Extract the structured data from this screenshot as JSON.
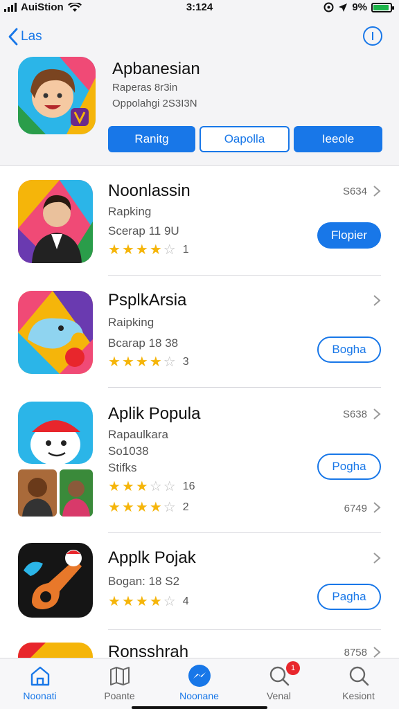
{
  "status_bar": {
    "carrier": "AuiStion",
    "time": "3:124",
    "battery": "9%",
    "battery_level": 0.9
  },
  "nav": {
    "back_label": "Las"
  },
  "hero": {
    "title": "Apbanesian",
    "subtitle_1": "Raperas 8r3in",
    "subtitle_2": "Oppolahgi 2S3I3N",
    "segments": [
      {
        "label": "Ranitg"
      },
      {
        "label": "Oapolla"
      },
      {
        "label": "Ieeole"
      }
    ]
  },
  "apps": [
    {
      "name": "Noonlassin",
      "line_1": "Rapking",
      "line_2": "Scerap 11 9U",
      "rating": 4.5,
      "count": "1",
      "number": "S634",
      "action": "Flopier"
    },
    {
      "name": "PsplkArsia",
      "line_1": "Raipking",
      "line_2": "Bcarap 18 38",
      "rating": 4.5,
      "count": "3",
      "action": "Bogha"
    },
    {
      "name": "Aplik Popula",
      "line_1": "Rapaulkara",
      "line_2": "So1038",
      "line_3": "Stifks",
      "rating": 3.0,
      "count": "16",
      "rating_2": 4.5,
      "count_2": "2",
      "number": "S638",
      "number_2": "6749",
      "action": "Pogha"
    },
    {
      "name": "Applk Pojak",
      "line_1": "Bogan: 18 S2",
      "rating": 4.5,
      "count": "4",
      "action": "Pagha"
    },
    {
      "name": "Ronsshrah",
      "number": "8758"
    }
  ],
  "tab_bar": {
    "tabs": [
      {
        "label": "Noonati",
        "icon": "home-icon"
      },
      {
        "label": "Poante",
        "icon": "map-icon"
      },
      {
        "label": "Noonane",
        "icon": "messenger-icon"
      },
      {
        "label": "Venal",
        "icon": "search-icon",
        "badge": "1"
      },
      {
        "label": "Kesiont",
        "icon": "search-icon"
      }
    ]
  },
  "colors": {
    "accent": "#1877e8",
    "star": "#f5b50a",
    "badge": "#e8262c"
  }
}
